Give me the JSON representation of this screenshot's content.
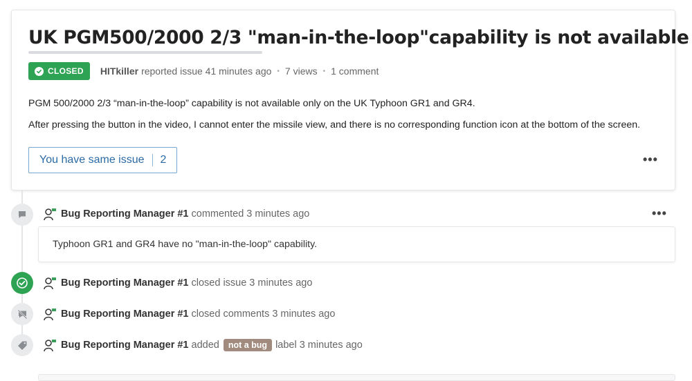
{
  "issue": {
    "title": "UK PGM500/2000 2/3 \"man-in-the-loop\"capability is not available",
    "status": "CLOSED",
    "author": "HITkiller",
    "reported_text": "reported issue 41 minutes ago",
    "views": "7 views",
    "comments": "1 comment",
    "body": [
      "PGM 500/2000 2/3 “man-in-the-loop” capability is not available only on the UK Typhoon GR1 and GR4.",
      "After pressing the button in the video, I cannot enter the missile view, and there is no corresponding function icon at the bottom of the screen."
    ],
    "same_issue_label": "You have same issue",
    "same_issue_count": "2",
    "more_label": "•••"
  },
  "timeline": [
    {
      "icon": "comment-icon",
      "user": "Bug Reporting Manager #1",
      "action": "commented",
      "time": "3 minutes ago",
      "comment": "Typhoon GR1 and GR4 have no \"man-in-the-loop\" capability.",
      "more_label": "•••"
    },
    {
      "icon": "check-circle-icon",
      "user": "Bug Reporting Manager #1",
      "action": "closed issue",
      "time": "3 minutes ago"
    },
    {
      "icon": "comment-off-icon",
      "user": "Bug Reporting Manager #1",
      "action": "closed comments",
      "time": "3 minutes ago"
    },
    {
      "icon": "tag-icon",
      "user": "Bug Reporting Manager #1",
      "action": "added",
      "label": "not a bug",
      "label_suffix": "label",
      "time": "3 minutes ago"
    }
  ],
  "colors": {
    "closed_green": "#2fa354",
    "link_blue": "#2b6aa5",
    "tag_brown": "#a08b7e"
  }
}
